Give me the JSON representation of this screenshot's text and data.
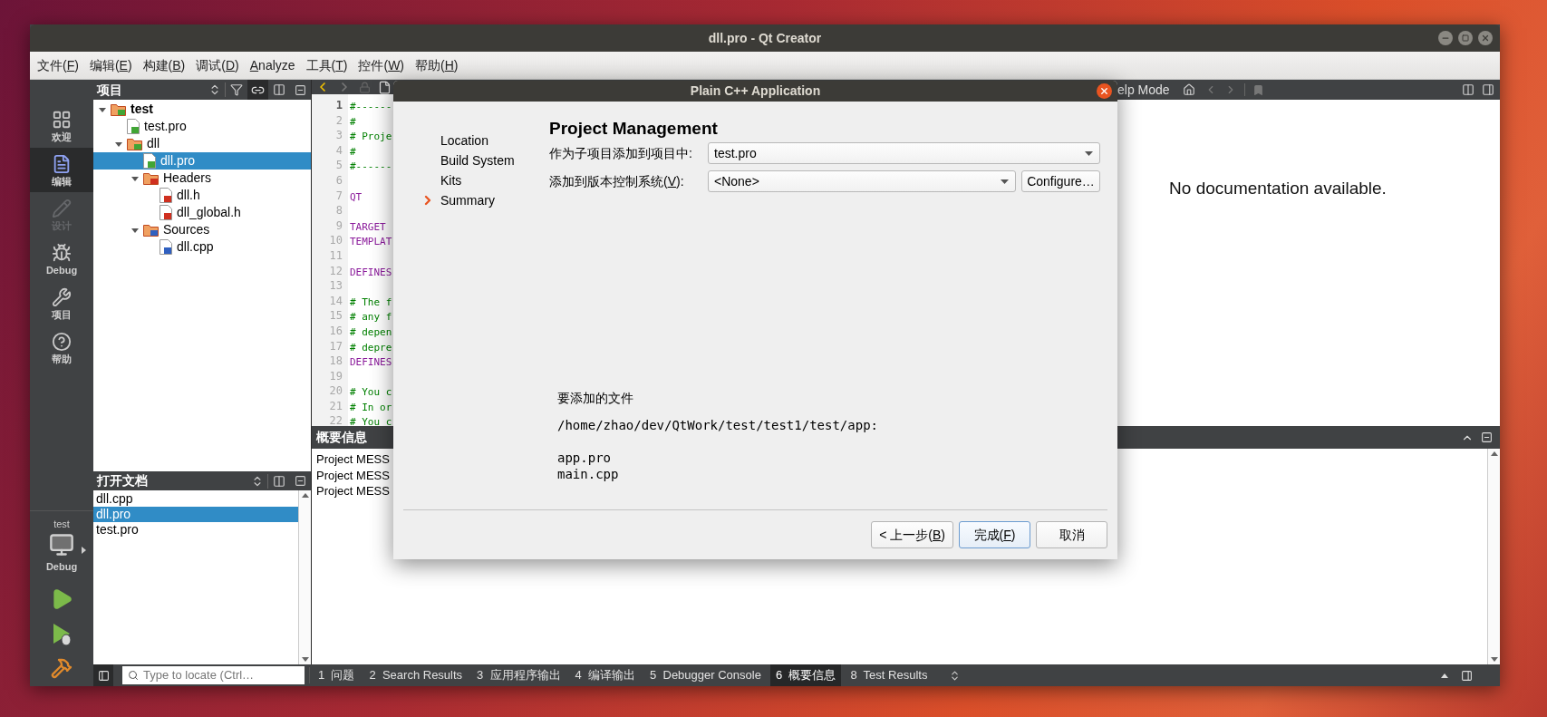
{
  "window": {
    "title": "dll.pro - Qt Creator"
  },
  "menu": [
    {
      "before": "文件(",
      "key": "F",
      "after": ")"
    },
    {
      "before": "编辑(",
      "key": "E",
      "after": ")"
    },
    {
      "before": "构建(",
      "key": "B",
      "after": ")"
    },
    {
      "before": "调试(",
      "key": "D",
      "after": ")"
    },
    {
      "key": "A",
      "after": "nalyze"
    },
    {
      "before": "工具(",
      "key": "T",
      "after": ")"
    },
    {
      "before": "控件(",
      "key": "W",
      "after": ")"
    },
    {
      "before": "帮助(",
      "key": "H",
      "after": ")"
    }
  ],
  "modes": [
    {
      "kind": "welcome",
      "label": "欢迎",
      "selected": false,
      "disabled": false
    },
    {
      "kind": "edit",
      "label": "编辑",
      "selected": true,
      "disabled": false
    },
    {
      "kind": "design",
      "label": "设计",
      "selected": false,
      "disabled": true
    },
    {
      "kind": "debug",
      "label": "Debug",
      "selected": false,
      "disabled": false
    },
    {
      "kind": "projects",
      "label": "项目",
      "selected": false,
      "disabled": false
    },
    {
      "kind": "help",
      "label": "帮助",
      "selected": false,
      "disabled": false
    }
  ],
  "target": {
    "project": "test",
    "config": "Debug"
  },
  "run_buttons": [
    {
      "kind": "run"
    },
    {
      "kind": "debug_run"
    },
    {
      "kind": "build"
    }
  ],
  "project_panel": {
    "title": "项目",
    "sync_active": true,
    "tree": [
      {
        "label": "test",
        "kind": "project",
        "startup": true,
        "expanded": true,
        "selected": false,
        "children": [
          {
            "label": "test.pro",
            "kind": "pro",
            "selected": false
          },
          {
            "label": "dll",
            "kind": "project",
            "startup": false,
            "expanded": true,
            "selected": false,
            "children": [
              {
                "label": "dll.pro",
                "kind": "pro",
                "selected": true
              },
              {
                "label": "Headers",
                "kind": "headers",
                "expanded": true,
                "selected": false,
                "children": [
                  {
                    "label": "dll.h",
                    "kind": "header",
                    "selected": false
                  },
                  {
                    "label": "dll_global.h",
                    "kind": "header",
                    "selected": false
                  }
                ]
              },
              {
                "label": "Sources",
                "kind": "sources",
                "expanded": true,
                "selected": false,
                "children": [
                  {
                    "label": "dll.cpp",
                    "kind": "source",
                    "selected": false
                  }
                ]
              }
            ]
          }
        ]
      }
    ]
  },
  "open_documents": {
    "title": "打开文档",
    "items": [
      {
        "label": "dll.cpp",
        "selected": false
      },
      {
        "label": "dll.pro",
        "selected": true
      },
      {
        "label": "test.pro",
        "selected": false
      }
    ]
  },
  "editor": {
    "lines": [
      {
        "number": "1",
        "text": "#------",
        "kind": "comment",
        "current": true
      },
      {
        "number": "2",
        "text": "#",
        "kind": "comment",
        "current": false
      },
      {
        "number": "3",
        "text": "# Proje",
        "kind": "comment",
        "current": false
      },
      {
        "number": "4",
        "text": "#",
        "kind": "comment",
        "current": false
      },
      {
        "number": "5",
        "text": "#------",
        "kind": "comment",
        "current": false
      },
      {
        "number": "6",
        "kind": "blank",
        "current": false
      },
      {
        "number": "7",
        "text": "QT",
        "kind": "keyword",
        "current": false
      },
      {
        "number": "8",
        "kind": "blank",
        "current": false
      },
      {
        "number": "9",
        "text": "TARGET",
        "kind": "keyword",
        "current": false
      },
      {
        "number": "10",
        "text": "TEMPLAT",
        "kind": "keyword",
        "current": false
      },
      {
        "number": "11",
        "kind": "blank",
        "current": false
      },
      {
        "number": "12",
        "text": "DEFINES",
        "kind": "keyword",
        "current": false
      },
      {
        "number": "13",
        "kind": "blank",
        "current": false
      },
      {
        "number": "14",
        "text": "# The f",
        "kind": "comment",
        "current": false
      },
      {
        "number": "15",
        "text": "# any f",
        "kind": "comment",
        "current": false
      },
      {
        "number": "16",
        "text": "# depen",
        "kind": "comment",
        "current": false
      },
      {
        "number": "17",
        "text": "# depre",
        "kind": "comment",
        "current": false
      },
      {
        "number": "18",
        "text": "DEFINES",
        "kind": "keyword",
        "current": false
      },
      {
        "number": "19",
        "kind": "blank",
        "current": false
      },
      {
        "number": "20",
        "text": "# You c",
        "kind": "comment",
        "current": false
      },
      {
        "number": "21",
        "text": "# In or",
        "kind": "comment",
        "current": false
      },
      {
        "number": "22",
        "text": "# You c",
        "kind": "comment",
        "current": false
      }
    ]
  },
  "help": {
    "mode_label": "elp Mode",
    "message": "No documentation available."
  },
  "output": {
    "title": "概要信息",
    "lines": [
      "Project MESS",
      "Project MESS",
      "Project MESS"
    ]
  },
  "bottom_bar": {
    "locate_placeholder": "Type to locate (Ctrl…",
    "tabs": [
      {
        "number": "1",
        "label": "问题",
        "selected": false
      },
      {
        "number": "2",
        "label": "Search Results",
        "selected": false
      },
      {
        "number": "3",
        "label": "应用程序输出",
        "selected": false
      },
      {
        "number": "4",
        "label": "编译输出",
        "selected": false
      },
      {
        "number": "5",
        "label": "Debugger Console",
        "selected": false
      },
      {
        "number": "6",
        "label": "概要信息",
        "selected": true
      },
      {
        "number": "8",
        "label": "Test Results",
        "selected": false
      }
    ]
  },
  "dialog": {
    "title": "Plain C++ Application",
    "steps": [
      {
        "label": "Location",
        "selected": false
      },
      {
        "label": "Build System",
        "selected": false
      },
      {
        "label": "Kits",
        "selected": false
      },
      {
        "label": "Summary",
        "selected": true
      }
    ],
    "heading": "Project Management",
    "fields": [
      {
        "label": {
          "text": "作为子项目添加到项目中:"
        },
        "value": "test.pro"
      },
      {
        "label": {
          "before": "添加到版本控制系统(",
          "key": "V",
          "after": "):"
        },
        "value": "<None>",
        "button": "Configure…"
      }
    ],
    "files_title": "要添加的文件",
    "files_path": "/home/zhao/dev/QtWork/test/test1/test/app:",
    "files": [
      "app.pro",
      "main.cpp"
    ],
    "buttons": [
      {
        "before": "< 上一步(",
        "key": "B",
        "after": ")",
        "default": false
      },
      {
        "before": "完成(",
        "key": "F",
        "after": ")",
        "default": true
      },
      {
        "text": "取消",
        "default": false
      }
    ]
  }
}
